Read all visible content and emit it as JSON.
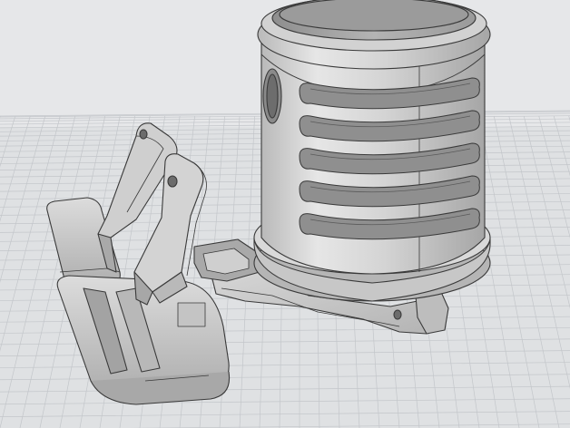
{
  "scene": {
    "kind": "cad-viewport",
    "background_color": "#dfe1e3",
    "grid": true,
    "grid_line_color": "#c3c6ca",
    "model_color": "#c9c9c9",
    "edge_color": "#3a3a3a",
    "objects": [
      "cup-holder-body",
      "mounting-bracket-arm",
      "hook-clip-arm",
      "base-foot-pad"
    ]
  }
}
